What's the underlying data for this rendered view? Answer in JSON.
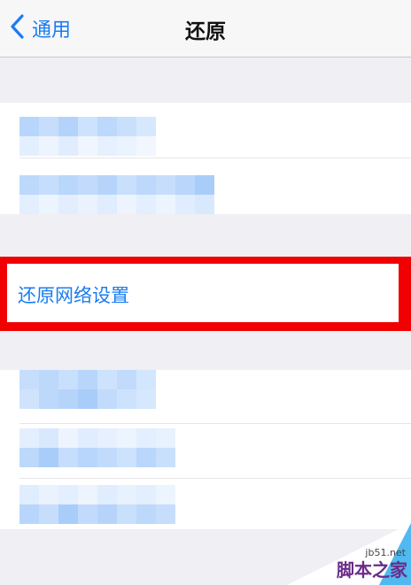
{
  "navbar": {
    "back_label": "通用",
    "title": "还原"
  },
  "reset_network": {
    "label": "还原网络设置"
  },
  "watermark": {
    "domain": "jb51.net",
    "name": "脚本之家"
  },
  "colors": {
    "accent": "#1a7cf0",
    "highlight": "#f00000",
    "background": "#efeff4",
    "cell": "#ffffff"
  },
  "icons": {
    "back": "chevron-left-icon"
  }
}
